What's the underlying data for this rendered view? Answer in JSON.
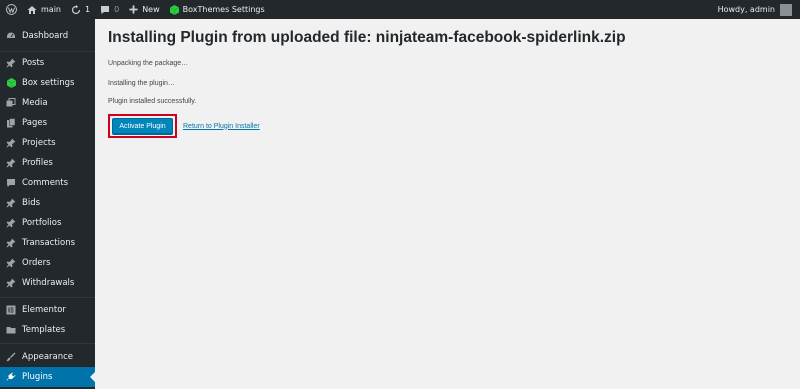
{
  "admin_bar": {
    "site_name": "main",
    "updates_count": "1",
    "comments_count": "0",
    "new_label": "New",
    "theme_settings_label": "BoxThemes Settings",
    "greeting": "Howdy, admin"
  },
  "sidebar": {
    "items": [
      {
        "label": "Dashboard",
        "icon": "dashboard-icon"
      },
      {
        "label": "Posts",
        "icon": "pin-icon"
      },
      {
        "label": "Box settings",
        "icon": "cube-icon"
      },
      {
        "label": "Media",
        "icon": "media-icon"
      },
      {
        "label": "Pages",
        "icon": "pages-icon"
      },
      {
        "label": "Projects",
        "icon": "pin-icon"
      },
      {
        "label": "Profiles",
        "icon": "pin-icon"
      },
      {
        "label": "Comments",
        "icon": "comment-icon"
      },
      {
        "label": "Bids",
        "icon": "pin-icon"
      },
      {
        "label": "Portfolios",
        "icon": "pin-icon"
      },
      {
        "label": "Transactions",
        "icon": "pin-icon"
      },
      {
        "label": "Orders",
        "icon": "pin-icon"
      },
      {
        "label": "Withdrawals",
        "icon": "pin-icon"
      },
      {
        "label": "Elementor",
        "icon": "elementor-icon"
      },
      {
        "label": "Templates",
        "icon": "folder-icon"
      },
      {
        "label": "Appearance",
        "icon": "brush-icon"
      },
      {
        "label": "Plugins",
        "icon": "plugin-icon"
      }
    ],
    "current": "Plugins"
  },
  "main": {
    "title": "Installing Plugin from uploaded file: ninjateam-facebook-spiderlink.zip",
    "messages": [
      "Unpacking the package…",
      "Installing the plugin…",
      "Plugin installed successfully."
    ],
    "activate_button": "Activate Plugin",
    "return_link": "Return to Plugin Installer"
  },
  "colors": {
    "admin_dark": "#23282d",
    "accent_blue": "#0073aa",
    "button_blue": "#0085ba",
    "highlight_red": "#d0021b",
    "background": "#f1f1f1",
    "box_settings_icon": "#2ecc40"
  }
}
